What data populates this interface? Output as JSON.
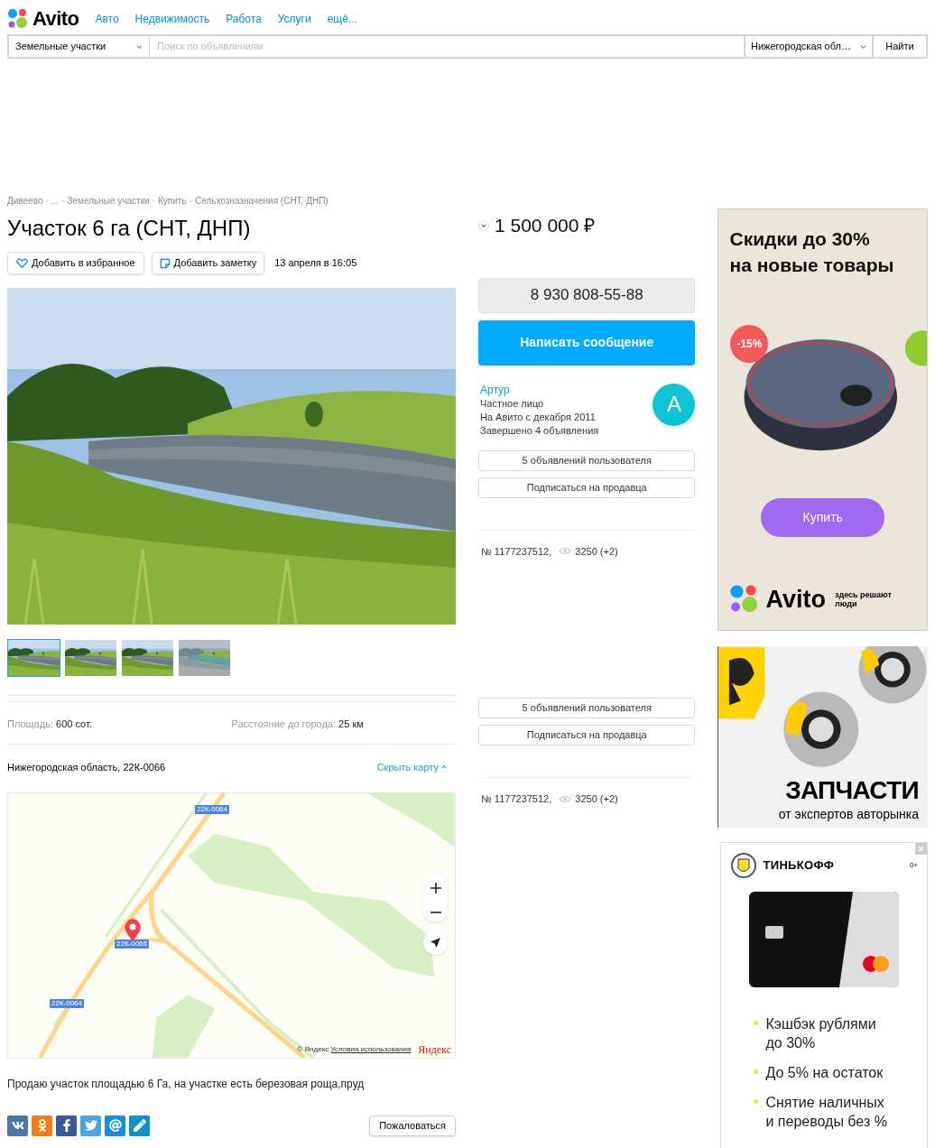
{
  "header": {
    "logo": "Avito",
    "nav": [
      "Авто",
      "Недвижимость",
      "Работа",
      "Услуги",
      "ещё..."
    ]
  },
  "search": {
    "category": "Земельные участки",
    "placeholder": "Поиск по объявлениям",
    "region": "Нижегородская обл…",
    "button": "Найти"
  },
  "breadcrumbs": {
    "separator": "·",
    "items": [
      "Дивеево",
      "...",
      "Земельные участки",
      "Купить",
      "Сельхозназначения (СНТ, ДНП)"
    ]
  },
  "title": "Участок 6 га (СНТ, ДНП)",
  "actions": {
    "favorite": "Добавить в избранное",
    "note": "Добавить заметку",
    "date": "13 апреля в 16:05"
  },
  "thumbnails": [
    {
      "kind": "picture",
      "selected": true
    },
    {
      "kind": "picture",
      "selected": false
    },
    {
      "kind": "picture",
      "selected": false
    },
    {
      "kind": "picture",
      "selected": false
    }
  ],
  "params": [
    {
      "label": "Площадь:",
      "value": "600 сот."
    },
    {
      "label": "Расстояние до города:",
      "value": "25 км"
    }
  ],
  "address": "Нижегородская область, 22К-0066",
  "hide_map": "Скрыть карту",
  "map": {
    "road_labels": [
      "22К-0064",
      "22К-0066",
      "22К-0064"
    ],
    "copyright": "© Яндекс",
    "terms": "Условия использования",
    "brand": "Яндекс"
  },
  "description": "Продаю участок площадью 6 Га, на участке есть березовая роща,пруд",
  "complaint": "Пожаловаться",
  "price": "1 500 000 ₽",
  "phone": "8 930 808-55-88",
  "message_button": "Написать сообщение",
  "seller": {
    "name": "Артур",
    "lines": [
      "Частное лицо",
      "На Авито с декабря 2011",
      "Завершено 4 объявления"
    ],
    "avatar": "A"
  },
  "seller_blocks": [
    {
      "buttons": [
        "5 объявлений пользователя",
        "Подписаться на продавца"
      ],
      "number": "№ 1177237512,",
      "views": "3250 (+2)"
    },
    {
      "buttons": [
        "5 объявлений пользователя",
        "Подписаться на продавца"
      ],
      "number": "№ 1177237512,",
      "views": "3250 (+2)"
    }
  ],
  "ad_sale": {
    "headline": [
      "Скидки до 30%",
      "на новые товары"
    ],
    "badge": "-15%",
    "button": "Купить",
    "brand": "Avito",
    "slogan": [
      "здесь решают",
      "люди"
    ]
  },
  "ad_parts": {
    "headline": "ЗАПЧАСТИ",
    "subline": "от экспертов авторынка"
  },
  "ad_bank": {
    "brand": "ТИНЬКОФФ",
    "age": "0+",
    "bullets": [
      [
        "Кэшбэк рублями",
        "до 30%"
      ],
      [
        "До 5% на остаток"
      ],
      [
        "Снятие наличных",
        "и переводы без %"
      ]
    ]
  }
}
